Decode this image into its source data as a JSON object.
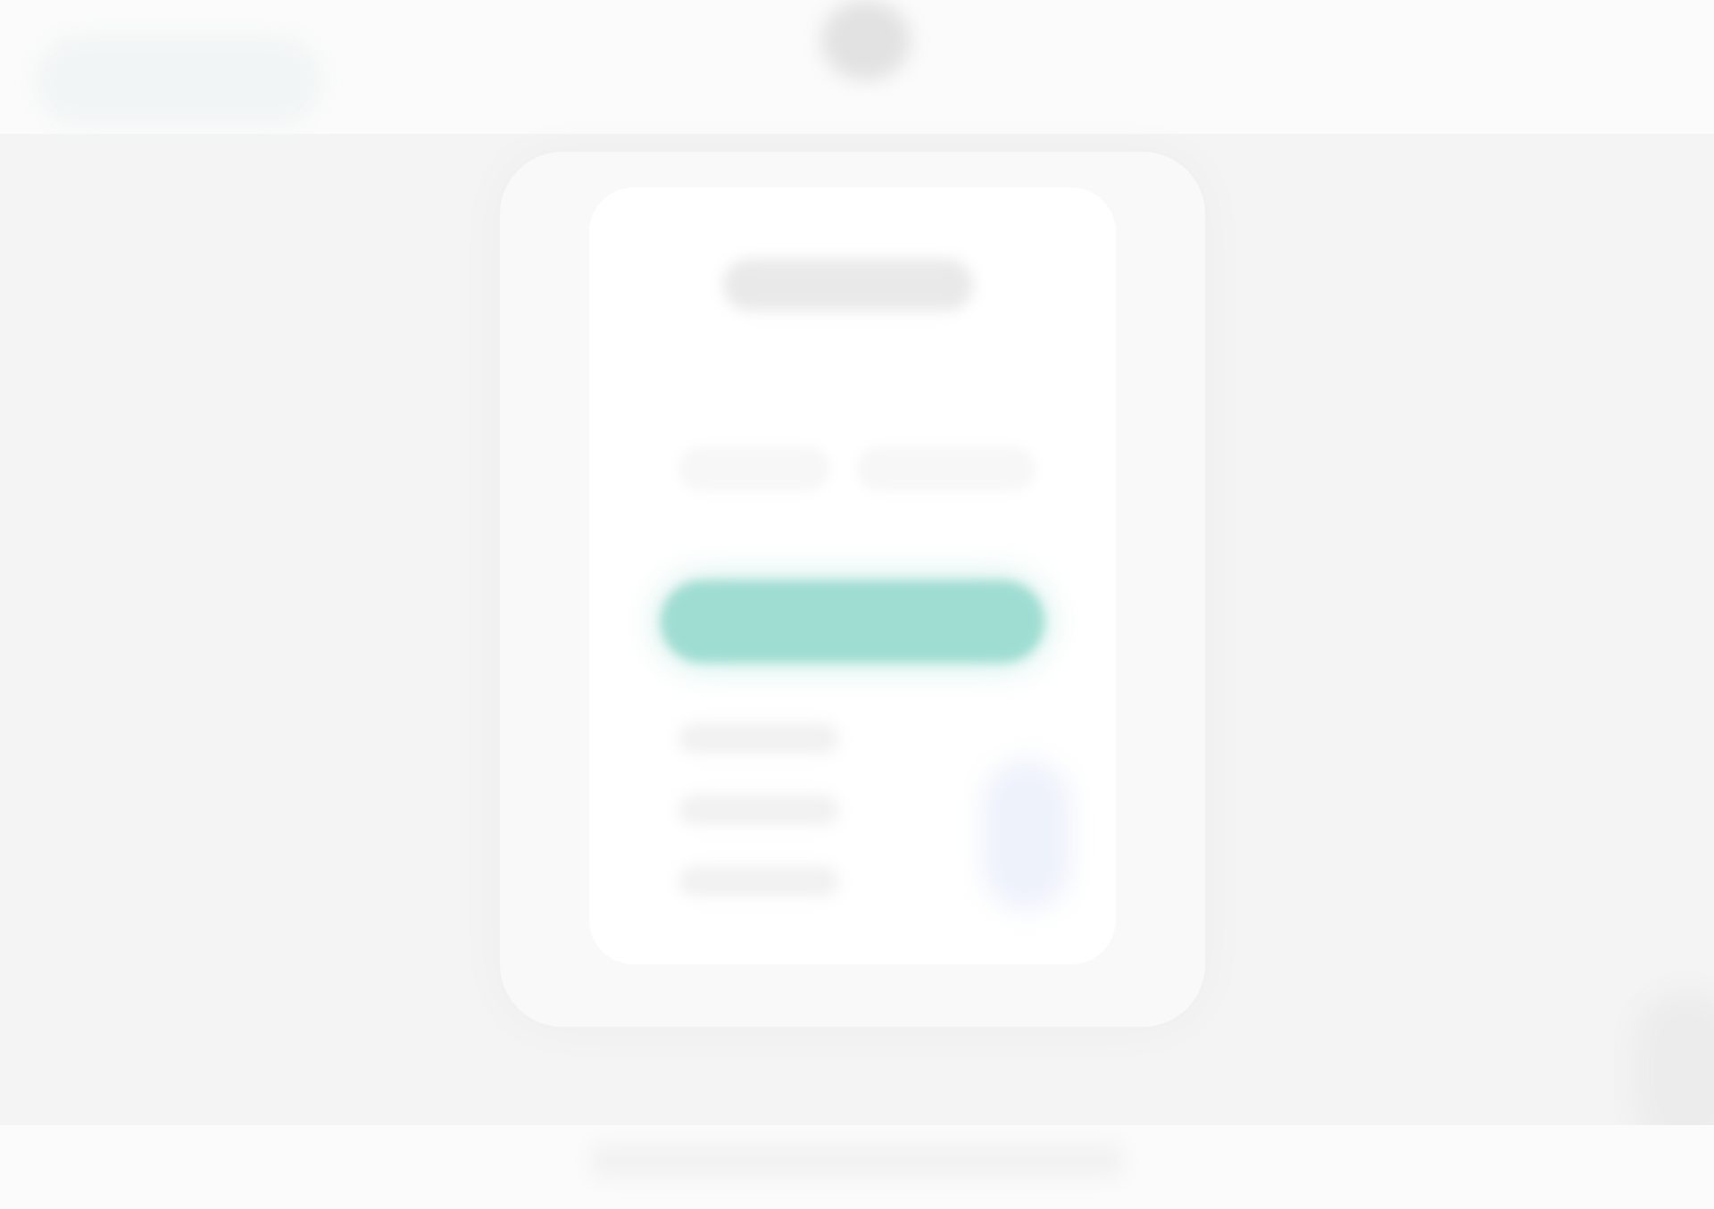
{
  "header": {
    "brand": "",
    "avatar_icon": "user-avatar-icon"
  },
  "card": {
    "title": "",
    "fields": [
      "",
      ""
    ],
    "primary_button_label": "",
    "info_lines": [
      "",
      "",
      ""
    ],
    "side_badge_icon": "badge-icon"
  },
  "footer": {
    "text": ""
  },
  "colors": {
    "background": "#f4f4f4",
    "card": "#ffffff",
    "accent": "#9fddd2",
    "badge": "#eef2fb"
  }
}
